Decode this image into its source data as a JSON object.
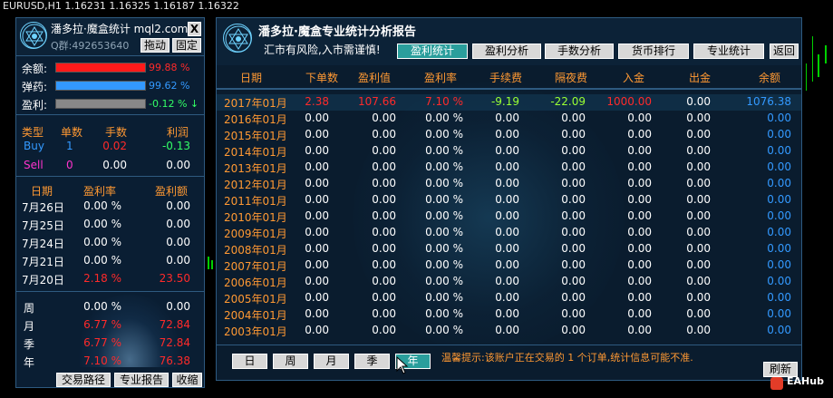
{
  "chart": {
    "title": "EURUSD,H1  1.16231 1.16325 1.16187 1.16322"
  },
  "left_panel": {
    "title": "潘多拉·魔盒统计 mql2.com",
    "account": "Q群:492653640",
    "close_label": "X",
    "drag_label": "拖动",
    "fix_label": "固定",
    "balance_label": "余额:",
    "balance_pct": "99.88 %",
    "balance_value": 0.9988,
    "ammo_label": "弹药:",
    "ammo_pct": "99.62 %",
    "ammo_value": 0.9962,
    "profit_label": "盈利:",
    "profit_pct": "-0.12 %",
    "profit_arrow": "↓",
    "trade_headers": [
      "类型",
      "单数",
      "手数",
      "利润"
    ],
    "trades": [
      {
        "type": "Buy",
        "count": "1",
        "lots": "0.02",
        "profit": "-0.13"
      },
      {
        "type": "Sell",
        "count": "0",
        "lots": "0.00",
        "profit": "0.00"
      }
    ],
    "daily_headers": [
      "日期",
      "盈利率",
      "盈利额"
    ],
    "daily": [
      {
        "date": "7月26日",
        "rate": "0.00 %",
        "amount": "0.00"
      },
      {
        "date": "7月25日",
        "rate": "0.00 %",
        "amount": "0.00"
      },
      {
        "date": "7月24日",
        "rate": "0.00 %",
        "amount": "0.00"
      },
      {
        "date": "7月21日",
        "rate": "0.00 %",
        "amount": "0.00"
      },
      {
        "date": "7月20日",
        "rate": "2.18 %",
        "amount": "23.50"
      }
    ],
    "periods": [
      {
        "label": "周",
        "rate": "0.00 %",
        "amount": "0.00"
      },
      {
        "label": "月",
        "rate": "6.77 %",
        "amount": "72.84"
      },
      {
        "label": "季",
        "rate": "6.77 %",
        "amount": "72.84"
      },
      {
        "label": "年",
        "rate": "7.10 %",
        "amount": "76.38"
      }
    ],
    "footer_buttons": [
      "交易路径",
      "专业报告",
      "收缩"
    ]
  },
  "main_panel": {
    "title": "潘多拉·魔盒专业统计分析报告",
    "subtitle": "汇市有风险,入市需谨慎!",
    "tabs": [
      "盈利统计",
      "盈利分析",
      "手数分析",
      "货币排行",
      "专业统计",
      "返回"
    ],
    "columns": [
      "日期",
      "下单数",
      "盈利值",
      "盈利率",
      "手续费",
      "隔夜费",
      "入金",
      "出金",
      "余额"
    ],
    "rows": [
      [
        "2017年01月",
        "2.38",
        "107.66",
        "7.10 %",
        "-9.19",
        "-22.09",
        "1000.00",
        "0.00",
        "1076.38"
      ],
      [
        "2016年01月",
        "0.00",
        "0.00",
        "0.00 %",
        "0.00",
        "0.00",
        "0.00",
        "0.00",
        "0.00"
      ],
      [
        "2015年01月",
        "0.00",
        "0.00",
        "0.00 %",
        "0.00",
        "0.00",
        "0.00",
        "0.00",
        "0.00"
      ],
      [
        "2014年01月",
        "0.00",
        "0.00",
        "0.00 %",
        "0.00",
        "0.00",
        "0.00",
        "0.00",
        "0.00"
      ],
      [
        "2013年01月",
        "0.00",
        "0.00",
        "0.00 %",
        "0.00",
        "0.00",
        "0.00",
        "0.00",
        "0.00"
      ],
      [
        "2012年01月",
        "0.00",
        "0.00",
        "0.00 %",
        "0.00",
        "0.00",
        "0.00",
        "0.00",
        "0.00"
      ],
      [
        "2011年01月",
        "0.00",
        "0.00",
        "0.00 %",
        "0.00",
        "0.00",
        "0.00",
        "0.00",
        "0.00"
      ],
      [
        "2010年01月",
        "0.00",
        "0.00",
        "0.00 %",
        "0.00",
        "0.00",
        "0.00",
        "0.00",
        "0.00"
      ],
      [
        "2009年01月",
        "0.00",
        "0.00",
        "0.00 %",
        "0.00",
        "0.00",
        "0.00",
        "0.00",
        "0.00"
      ],
      [
        "2008年01月",
        "0.00",
        "0.00",
        "0.00 %",
        "0.00",
        "0.00",
        "0.00",
        "0.00",
        "0.00"
      ],
      [
        "2007年01月",
        "0.00",
        "0.00",
        "0.00 %",
        "0.00",
        "0.00",
        "0.00",
        "0.00",
        "0.00"
      ],
      [
        "2006年01月",
        "0.00",
        "0.00",
        "0.00 %",
        "0.00",
        "0.00",
        "0.00",
        "0.00",
        "0.00"
      ],
      [
        "2005年01月",
        "0.00",
        "0.00",
        "0.00 %",
        "0.00",
        "0.00",
        "0.00",
        "0.00",
        "0.00"
      ],
      [
        "2004年01月",
        "0.00",
        "0.00",
        "0.00 %",
        "0.00",
        "0.00",
        "0.00",
        "0.00",
        "0.00"
      ],
      [
        "2003年01月",
        "0.00",
        "0.00",
        "0.00 %",
        "0.00",
        "0.00",
        "0.00",
        "0.00",
        "0.00"
      ]
    ],
    "period_buttons": [
      "日",
      "周",
      "月",
      "季",
      "年"
    ],
    "active_period": 4,
    "warning": "温馨提示:该账户正在交易的 1 个订单,统计信息可能不准.",
    "refresh_label": "刷新"
  },
  "watermark": {
    "text": "EAHub"
  },
  "colors": {
    "orange": "#ff9933",
    "red": "#ff2a2a",
    "green": "#33ff66",
    "yellowgreen": "#99ff33",
    "magenta": "#ff33cc",
    "blue": "#3399ff",
    "teal": "#2a9e9c",
    "panel": "#0a1c2e"
  }
}
